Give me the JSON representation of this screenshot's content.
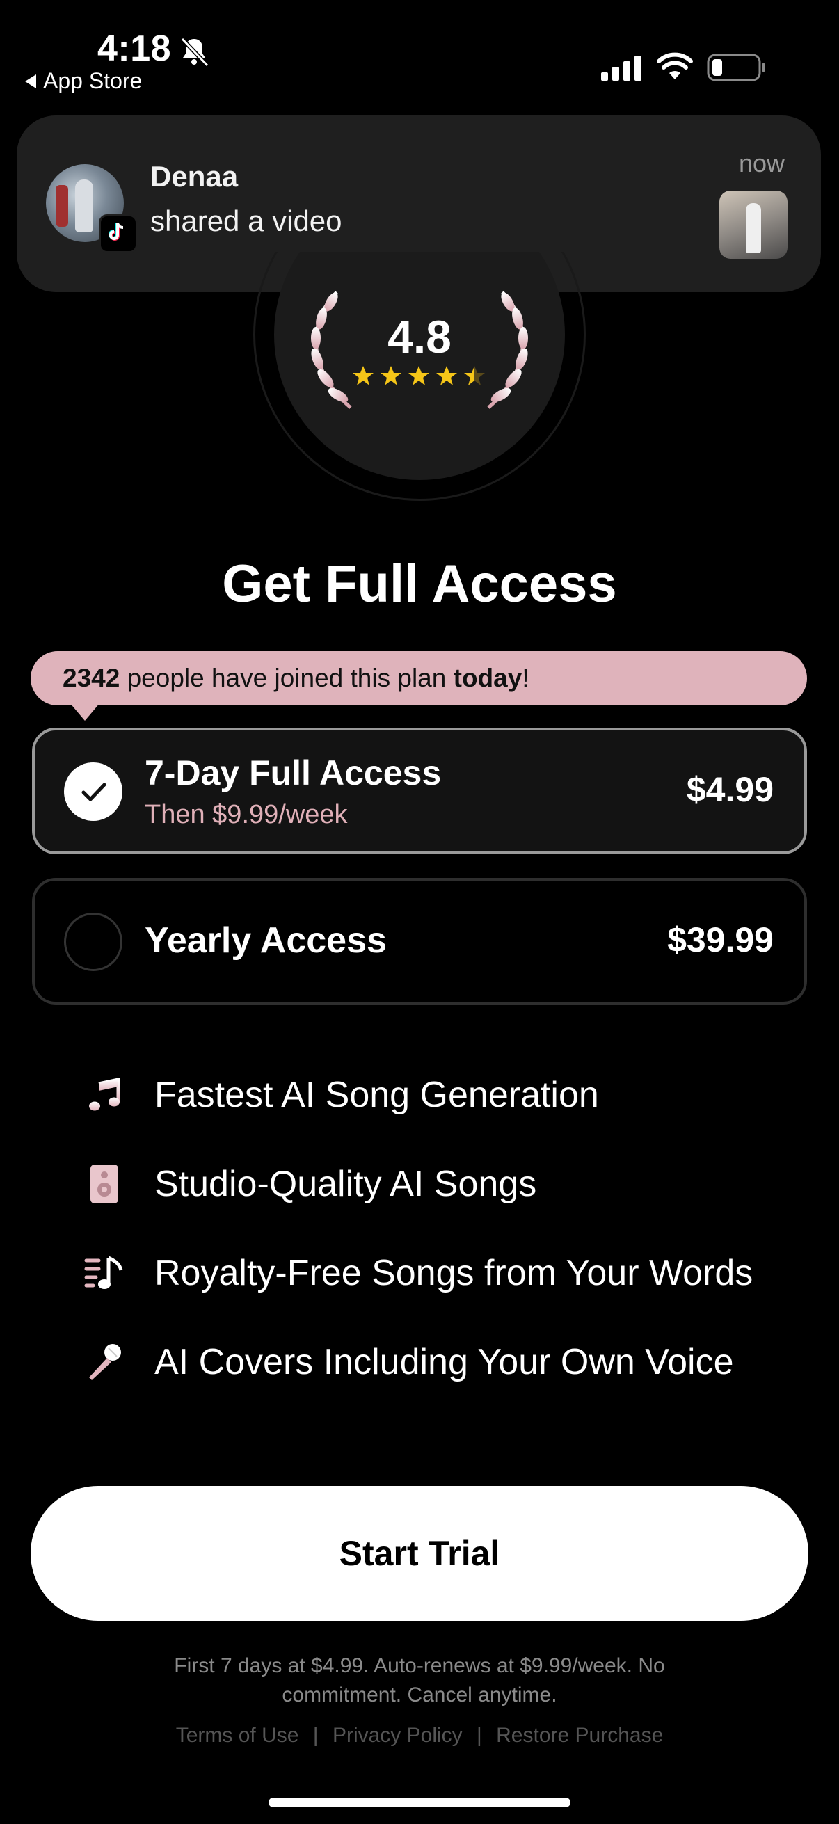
{
  "status_bar": {
    "time": "4:18",
    "back_label": "App Store"
  },
  "notification": {
    "sender": "Denaa",
    "message": "shared a video",
    "time": "now"
  },
  "rating": {
    "value": "4.8",
    "stars": 4.5
  },
  "title": "Get Full Access",
  "banner": {
    "count": "2342",
    "middle": " people have joined this plan ",
    "emphasis": "today",
    "end": "!"
  },
  "plans": [
    {
      "name": "7-Day Full Access",
      "subtitle": "Then $9.99/week",
      "price": "$4.99",
      "selected": true
    },
    {
      "name": "Yearly Access",
      "price": "$39.99",
      "selected": false
    }
  ],
  "features": [
    {
      "icon": "music-note-icon",
      "text": "Fastest AI Song Generation"
    },
    {
      "icon": "speaker-icon",
      "text": "Studio-Quality AI Songs"
    },
    {
      "icon": "lyrics-music-icon",
      "text": "Royalty-Free Songs from Your Words"
    },
    {
      "icon": "microphone-icon",
      "text": "AI Covers Including Your Own Voice"
    }
  ],
  "cta_label": "Start Trial",
  "fine_print": "First 7 days at $4.99. Auto-renews at $9.99/week. No commitment. Cancel anytime.",
  "links": {
    "terms": "Terms of Use",
    "privacy": "Privacy Policy",
    "restore": "Restore Purchase",
    "separator": "|"
  },
  "colors": {
    "accent_pink": "#dfb3bb",
    "star_gold": "#f5c518",
    "background": "#000000"
  }
}
